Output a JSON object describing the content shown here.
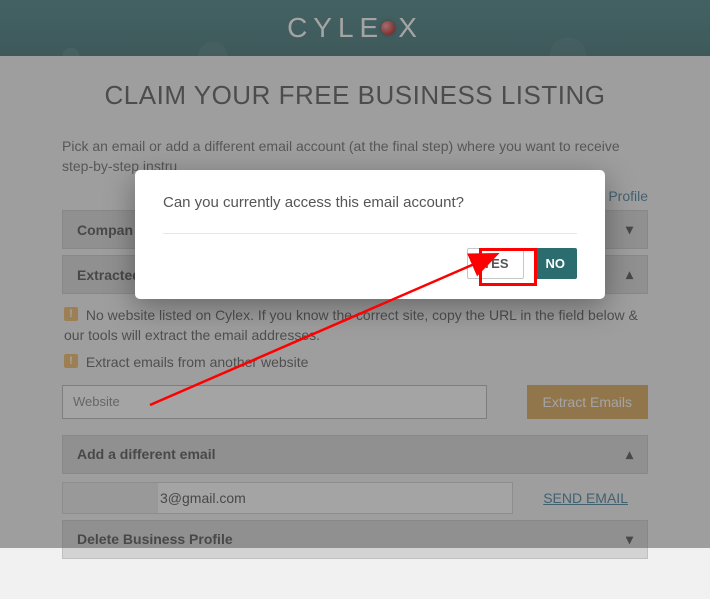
{
  "logo": {
    "text_left": "CYLE",
    "text_right": "X"
  },
  "title": "CLAIM YOUR FREE BUSINESS LISTING",
  "intro": "Pick an email or add a different email account (at the final step) where you want to receive step-by-step instru",
  "profile_link_suffix": "ess Profile",
  "sections": {
    "company": {
      "label": "Compan"
    },
    "extracted": {
      "label": "Extracted",
      "info1": "No website listed on Cylex. If you know the correct site, copy the URL in the field below & our tools will extract the email addresses.",
      "info2": "Extract emails from another website",
      "website_placeholder": "Website",
      "extract_btn": "Extract Emails"
    },
    "add_email": {
      "label": "Add a different email",
      "email_suffix": "3@gmail.com",
      "send_link": "SEND EMAIL"
    },
    "delete": {
      "label": "Delete Business Profile"
    }
  },
  "modal": {
    "question": "Can you currently access this email account?",
    "yes": "YES",
    "no": "NO"
  },
  "icons": {
    "info": "!"
  }
}
